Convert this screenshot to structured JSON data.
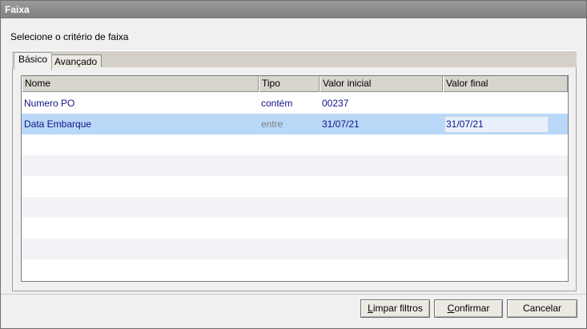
{
  "window": {
    "title": "Faixa"
  },
  "instruction": "Selecione o critério de faixa",
  "tabs": [
    {
      "label": "Básico",
      "active": true
    },
    {
      "label": "Avançado",
      "active": false
    }
  ],
  "grid": {
    "columns": [
      "Nome",
      "Tipo",
      "Valor inicial",
      "Valor final"
    ],
    "rows": [
      {
        "nome": "Numero PO",
        "tipo": "contém",
        "valor_inicial": "00237",
        "valor_final": ""
      },
      {
        "nome": "Data Embarque",
        "tipo": "entre",
        "valor_inicial": "31/07/21",
        "valor_final": "31/07/21"
      }
    ]
  },
  "buttons": {
    "limpar": {
      "first": "L",
      "rest": "impar filtros"
    },
    "confirmar": {
      "first": "C",
      "rest": "onfirmar"
    },
    "cancelar": {
      "label": "Cancelar"
    }
  },
  "colors": {
    "selected_row": "#b9d8f7",
    "link_text": "#13138a",
    "title_bar": "#808080"
  }
}
